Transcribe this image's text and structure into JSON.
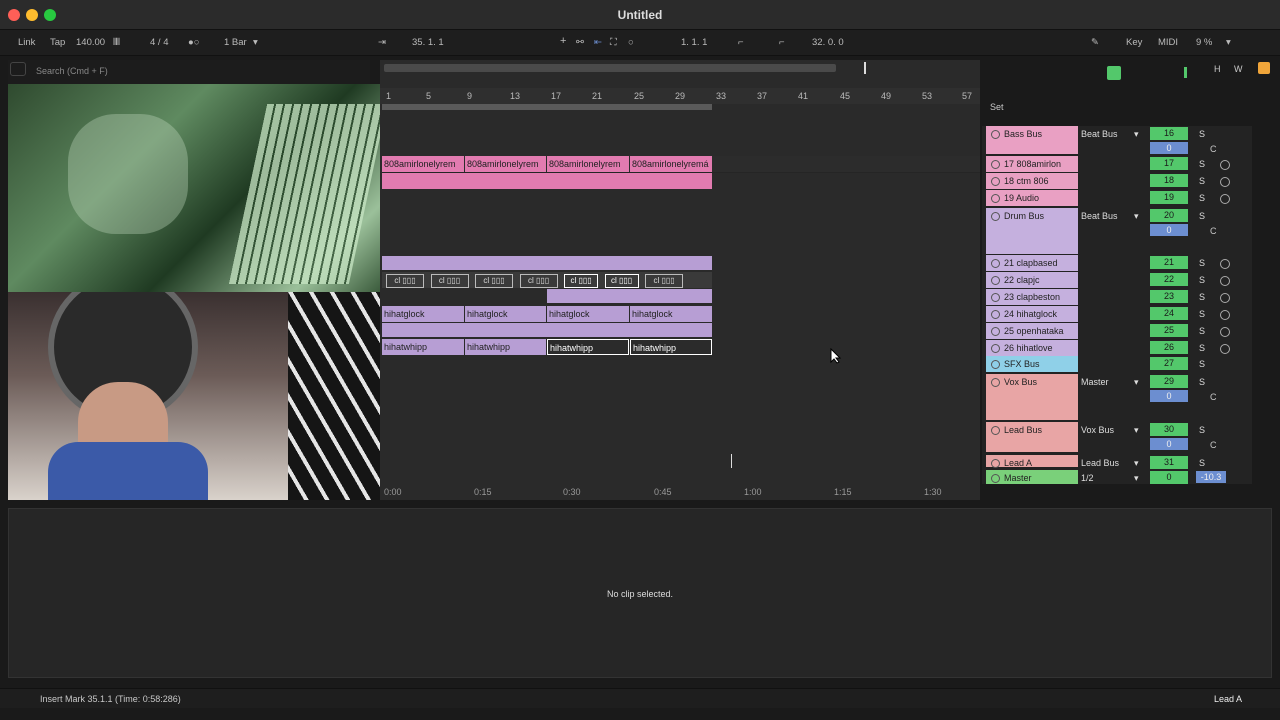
{
  "window": {
    "title": "Untitled"
  },
  "control_bar": {
    "link": "Link",
    "tap": "Tap",
    "tempo": "140.00",
    "signature": "4 / 4",
    "quantize": "1 Bar",
    "position": "35.   1.   1",
    "loop_start": "1.   1.   1",
    "loop_length": "32.   0.   0",
    "key": "Key",
    "midi": "MIDI",
    "cpu": "9 %"
  },
  "browser": {
    "search_placeholder": "Search (Cmd + F)"
  },
  "timeline": {
    "bars": [
      "1",
      "5",
      "9",
      "13",
      "17",
      "21",
      "25",
      "29",
      "33",
      "37",
      "41",
      "45",
      "49",
      "53",
      "57"
    ],
    "times": [
      "0:00",
      "0:15",
      "0:30",
      "0:45",
      "1:00",
      "1:15",
      "1:30"
    ]
  },
  "clips": {
    "bass_name": "808amirlonelyrem",
    "bass_name_last": "808amirlonelyremá",
    "clap_name": "cl",
    "hihat_glock": "hihatglock",
    "hihat_whipp": "hihatwhipp"
  },
  "set_header": "Set",
  "tracks": [
    {
      "name": "Bass Bus",
      "route": "Beat Bus",
      "num": "16",
      "vol": "0",
      "group": true
    },
    {
      "name": "17 808amirlon",
      "num": "17"
    },
    {
      "name": "18 ctm 806",
      "num": "18"
    },
    {
      "name": "19 Audio",
      "num": "19"
    },
    {
      "name": "Drum Bus",
      "route": "Beat Bus",
      "num": "20",
      "vol": "0",
      "group": true
    },
    {
      "name": "21 clapbased",
      "num": "21"
    },
    {
      "name": "22 clapjc",
      "num": "22"
    },
    {
      "name": "23 clapbeston",
      "num": "23"
    },
    {
      "name": "24 hihatglock",
      "num": "24"
    },
    {
      "name": "25 openhataka",
      "num": "25"
    },
    {
      "name": "26 hihatlove",
      "num": "26"
    },
    {
      "name": "SFX Bus",
      "num": "27"
    },
    {
      "name": "Vox Bus",
      "route": "Master",
      "num": "29",
      "vol": "0",
      "group": true
    },
    {
      "name": "Lead Bus",
      "route": "Vox Bus",
      "num": "30",
      "vol": "0",
      "group": true
    },
    {
      "name": "Lead A",
      "route": "Lead Bus",
      "num": "31"
    },
    {
      "name": "Master",
      "route": "1/2",
      "num": "0",
      "vol": "-10.3"
    }
  ],
  "solo_label": "S",
  "c_label": "C",
  "detail": {
    "message": "No clip selected."
  },
  "status": {
    "left": "Insert Mark 35.1.1 (Time: 0:58:286)",
    "right": "Lead A"
  },
  "hw": {
    "h": "H",
    "w": "W"
  },
  "colors": {
    "bass": "#e27bb0",
    "drum": "#b79ed4",
    "meter": "#53c86b",
    "volume": "#6c8ed0"
  }
}
